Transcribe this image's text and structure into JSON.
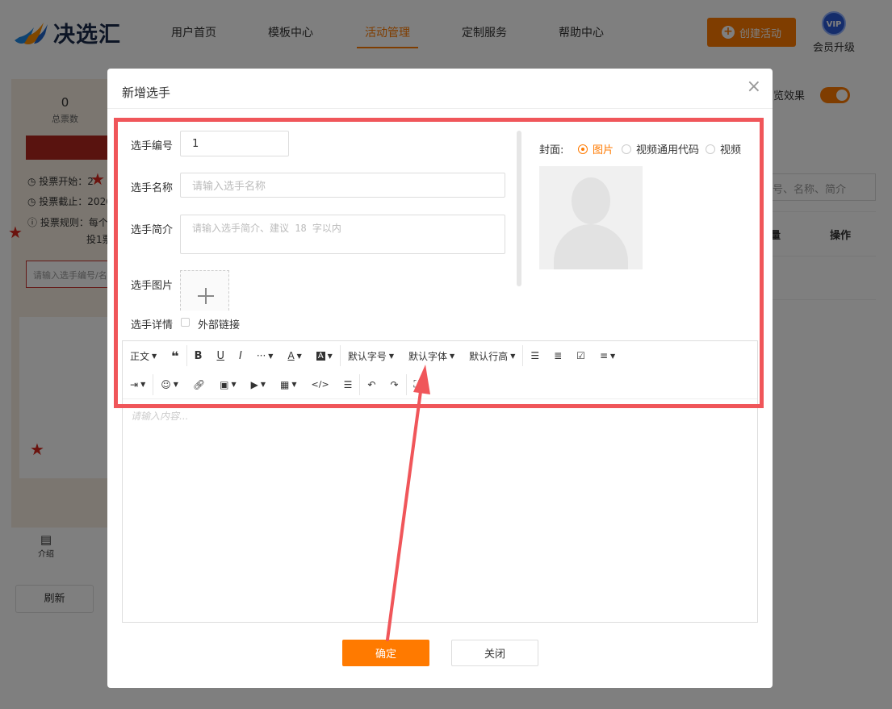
{
  "header": {
    "logo_text": "决选汇",
    "nav": [
      "用户首页",
      "模板中心",
      "活动管理",
      "定制服务",
      "帮助中心"
    ],
    "active_nav_index": 2,
    "create_button": "创建活动",
    "vip_badge": "VIP",
    "vip_label": "会员升级"
  },
  "left_panel": {
    "total_votes_value": "0",
    "total_votes_label": "总票数",
    "vote_start": "投票开始：2",
    "vote_end": "投票截止：2026",
    "vote_rule": "投票规则：每个",
    "vote_rule_2": "投1票",
    "search_placeholder": "请输入选手编号/名",
    "tab_intro": "介绍",
    "refresh_button": "刷新"
  },
  "right_panel": {
    "preview_label": "览效果",
    "preview_toggle": true,
    "search_placeholder": "号、名称、简介",
    "column_header_partial": "量",
    "column_header_action": "操作"
  },
  "modal": {
    "title": "新增选手",
    "close_icon": "×",
    "fields": {
      "number_label": "选手编号",
      "number_value": "1",
      "name_label": "选手名称",
      "name_placeholder": "请输入选手名称",
      "intro_label": "选手简介",
      "intro_placeholder": "请输入选手简介、建议 18 字以内",
      "image_label": "选手图片",
      "detail_label": "选手详情",
      "external_link_label": "外部链接",
      "external_link_checked": false
    },
    "cover": {
      "label": "封面:",
      "options": [
        "图片",
        "视频通用代码",
        "视频"
      ],
      "selected_index": 0
    },
    "editor": {
      "row1": [
        "正文",
        "❝",
        "B",
        "U",
        "I",
        "···",
        "A",
        "A",
        "默认字号",
        "默认字体",
        "默认行高"
      ],
      "placeholder": "请输入内容..."
    },
    "confirm_button": "确定",
    "close_button": "关闭"
  },
  "colors": {
    "accent": "#ff7a00",
    "annotation": "#f0565a"
  }
}
